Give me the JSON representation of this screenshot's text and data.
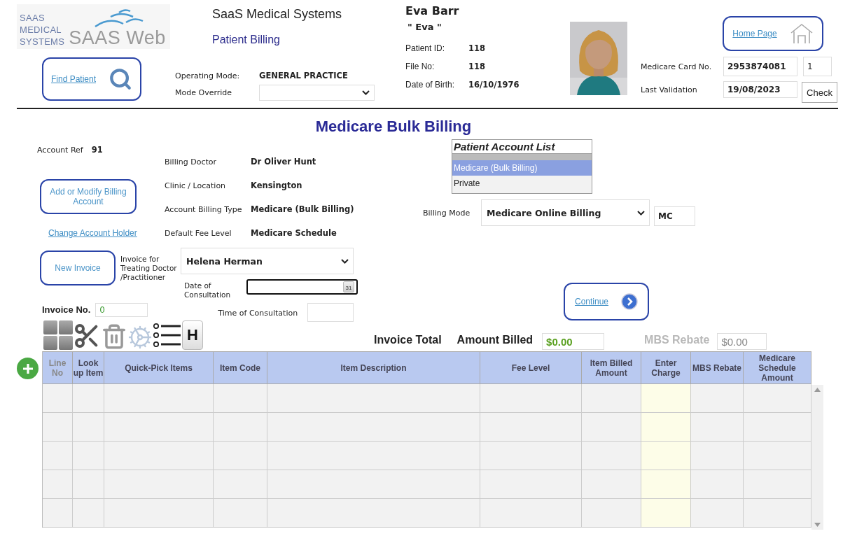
{
  "logo": {
    "lines": [
      "SAAS",
      "MEDICAL",
      "SYSTEMS"
    ],
    "wordmark": "SAAS Web"
  },
  "header": {
    "company": "SaaS Medical Systems",
    "module": "Patient Billing"
  },
  "find_patient": {
    "label": "Find Patient"
  },
  "operating_mode": {
    "label": "Operating Mode:",
    "value": "GENERAL PRACTICE"
  },
  "mode_override": {
    "label": "Mode Override"
  },
  "patient": {
    "name": "Eva Barr",
    "preferred_name": "\" Eva \"",
    "fields": [
      {
        "label": "Patient ID:",
        "value": "118"
      },
      {
        "label": "File No:",
        "value": "118"
      },
      {
        "label": "Date of Birth:",
        "value": "16/10/1976"
      }
    ]
  },
  "home": {
    "label": "Home Page"
  },
  "medicare": {
    "card_label": "Medicare Card No.",
    "card_number": "2953874081",
    "card_ref": "1",
    "validation_label": "Last Validation",
    "validation_date": "19/08/2023",
    "check_button": "Check"
  },
  "page_title": "Medicare Bulk Billing",
  "account": {
    "ref_label": "Account Ref",
    "ref_value": "91",
    "add_modify_button": "Add or Modify Billing Account",
    "change_holder_link": "Change Account Holder"
  },
  "details": [
    {
      "label": "Billing Doctor",
      "value": "Dr Oliver Hunt"
    },
    {
      "label": "Clinic / Location",
      "value": "Kensington"
    },
    {
      "label": "Account Billing Type",
      "value": "Medicare (Bulk Billing)"
    },
    {
      "label": "Default Fee Level",
      "value": "Medicare Schedule"
    }
  ],
  "patient_account_list": {
    "title": "Patient Account List",
    "items": [
      {
        "label": "Medicare (Bulk Billing)",
        "selected": true
      },
      {
        "label": "Private",
        "selected": false
      }
    ]
  },
  "billing_mode": {
    "label": "Billing Mode",
    "value": "Medicare Online Billing",
    "code": "MC"
  },
  "invoice": {
    "new_button": "New Invoice",
    "doctor_label": "Invoice for Treating Doctor /Practitioner",
    "doctor": "Helena Herman",
    "date_label": "Date of Consultation",
    "date_focused": true,
    "calendar_day": "31",
    "number_label": "Invoice No.",
    "number": "0",
    "time_label": "Time of Consultation",
    "continue": "Continue"
  },
  "toolbar": [
    {
      "kind": "grid"
    },
    {
      "kind": "scissors"
    },
    {
      "kind": "trash"
    },
    {
      "kind": "gears"
    },
    {
      "kind": "list"
    },
    {
      "kind": "key",
      "label": "H"
    }
  ],
  "totals": {
    "title": "Invoice Total",
    "billed_label": "Amount Billed",
    "billed": "$0.00",
    "rebate_label": "MBS Rebate",
    "rebate": "$0.00",
    "rebate_disabled": true
  },
  "table": {
    "columns": [
      {
        "label": "Line No",
        "disabled": true,
        "kind": "text"
      },
      {
        "label": "Look up Item",
        "disabled": false,
        "kind": "text"
      },
      {
        "label": "Quick-Pick Items",
        "disabled": false,
        "kind": "text"
      },
      {
        "label": "Item Code",
        "disabled": false,
        "kind": "text"
      },
      {
        "label": "Item Description",
        "disabled": false,
        "kind": "text"
      },
      {
        "label": "Fee Level",
        "disabled": false,
        "kind": "text"
      },
      {
        "label": "Item Billed Amount",
        "disabled": false,
        "kind": "text"
      },
      {
        "label": "Enter Charge",
        "disabled": false,
        "kind": "entry"
      },
      {
        "label": "MBS Rebate",
        "disabled": false,
        "kind": "text"
      },
      {
        "label": "Medicare Schedule Amount",
        "disabled": false,
        "kind": "text"
      }
    ]
  }
}
